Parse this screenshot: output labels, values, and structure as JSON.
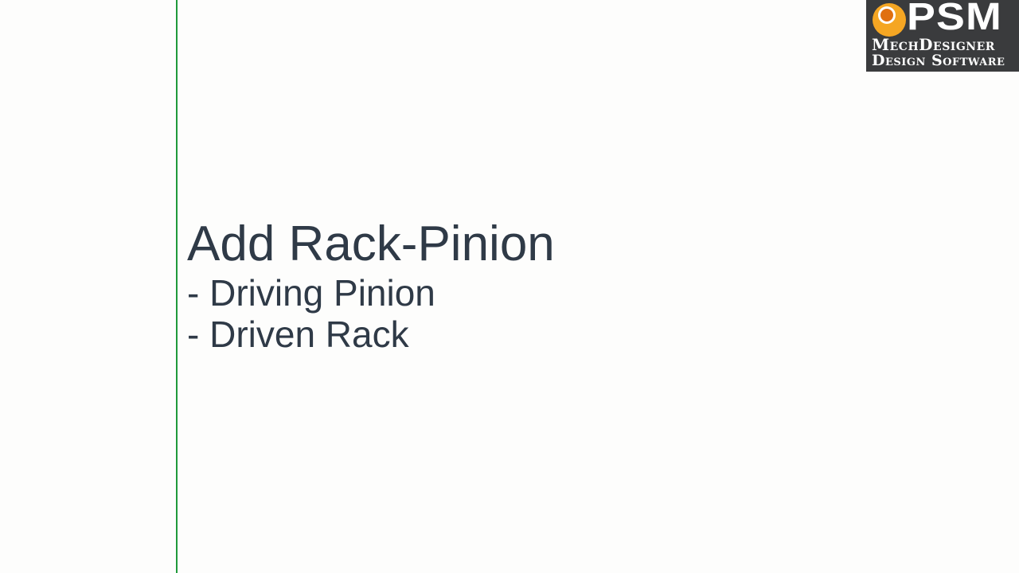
{
  "slide": {
    "title": "Add Rack-Pinion",
    "subtitle_lines": [
      "- Driving Pinion",
      "- Driven Rack"
    ]
  },
  "logo": {
    "letters": "PSM",
    "line1": "MechDesigner",
    "line2": "Design Software",
    "icon": "psm-circle-logo-icon"
  },
  "colors": {
    "background": "#fdfdfc",
    "accent_line": "#1f9a3b",
    "title_text": "#2f3a47",
    "logo_background": "#3a3b3d",
    "logo_orange": "#f5a623",
    "logo_dark_orange": "#e07010"
  }
}
